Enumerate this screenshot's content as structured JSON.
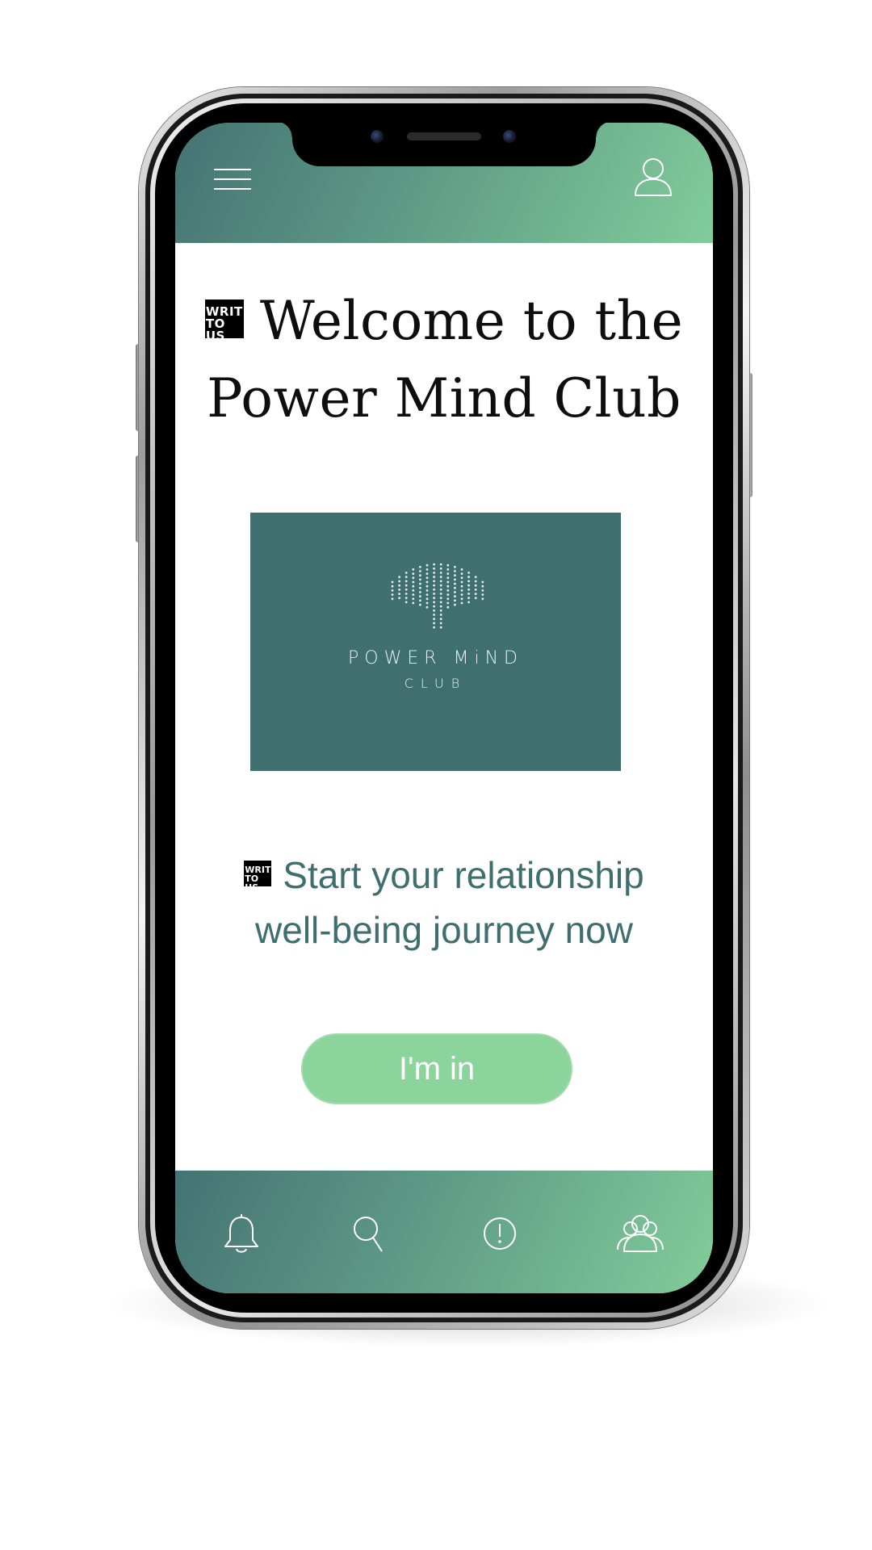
{
  "header": {
    "menu_icon": "hamburger-menu-icon",
    "profile_icon": "user-profile-icon",
    "gradient_colors": [
      "#447373",
      "#82cc9a"
    ]
  },
  "main": {
    "badge": {
      "line1": "WRITE",
      "line2": "TO US"
    },
    "welcome_title": {
      "line1": "Welcome to the",
      "line2": "Power Mind Club"
    },
    "logo": {
      "name_line1": "POWER MiND",
      "name_line2": "CLUB",
      "background_color": "#3f6f6f"
    },
    "tagline": {
      "line1": "Start your relationship",
      "line2": "well-being journey now"
    },
    "cta_label": "I'm in"
  },
  "bottom_nav": {
    "items": [
      {
        "icon": "bell-icon"
      },
      {
        "icon": "search-icon"
      },
      {
        "icon": "alert-icon"
      },
      {
        "icon": "group-icon"
      }
    ]
  },
  "colors": {
    "accent": "#8bd49c",
    "text_teal": "#3f6e6e",
    "title_text": "#0e0e0e"
  }
}
